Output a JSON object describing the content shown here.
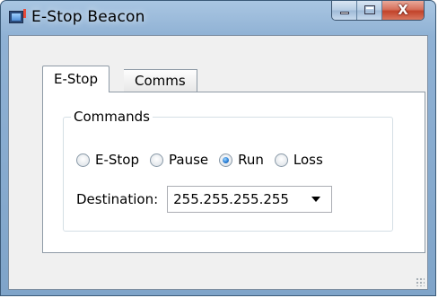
{
  "window": {
    "title": "E-Stop Beacon",
    "close_glyph": "X"
  },
  "tabs": [
    {
      "label": "E-Stop",
      "active": true
    },
    {
      "label": "Comms",
      "active": false
    }
  ],
  "commands": {
    "group_title": "Commands",
    "options": [
      {
        "label": "E-Stop",
        "checked": false
      },
      {
        "label": "Pause",
        "checked": false
      },
      {
        "label": "Run",
        "checked": true
      },
      {
        "label": "Loss",
        "checked": false
      }
    ],
    "destination_label": "Destination:",
    "destination_value": "255.255.255.255"
  },
  "icons": [
    "app-icon",
    "minimize-icon",
    "maximize-icon",
    "close-icon",
    "chevron-down-icon",
    "resize-grip-icon"
  ],
  "colors": {
    "frame": "#8fb1d4",
    "close_button": "#c2432a",
    "radio_checked": "#2b7fd6"
  }
}
